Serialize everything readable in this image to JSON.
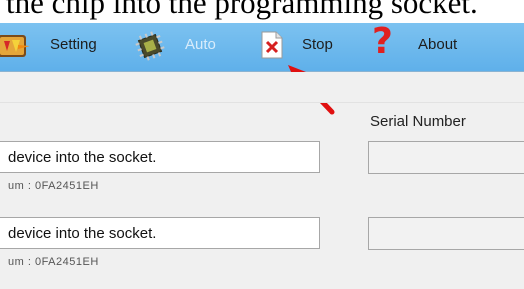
{
  "caption_fragment": "the chip into the programming socket.",
  "toolbar": {
    "items": [
      {
        "label": "Setting",
        "icon": "setting-icon",
        "enabled": true
      },
      {
        "label": "Auto",
        "icon": "chip-icon",
        "enabled": false
      },
      {
        "label": "Stop",
        "icon": "stop-icon",
        "enabled": true
      },
      {
        "label": "About",
        "icon": "question-mark-icon",
        "enabled": true
      }
    ]
  },
  "columns": {
    "serial_number": "Serial Number"
  },
  "sockets": [
    {
      "message": "device into the socket.",
      "checksum": "um : 0FA2451EH",
      "serial": ""
    },
    {
      "message": "device into the socket.",
      "checksum": "um : 0FA2451EH",
      "serial": ""
    }
  ],
  "colors": {
    "toolbar": "#6ab8ee",
    "stop_x": "#d62020",
    "about_question": "#e02020",
    "annotation_arrow": "#e01010"
  }
}
